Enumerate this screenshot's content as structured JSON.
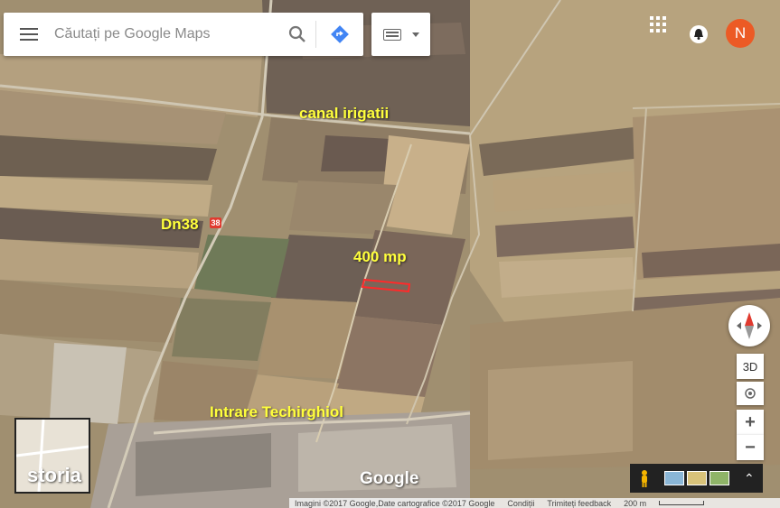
{
  "search": {
    "placeholder": "Căutați pe Google Maps"
  },
  "user": {
    "avatar_letter": "N"
  },
  "map_labels": {
    "canal": "canal irigatii",
    "road": "Dn38",
    "road_shield": "38",
    "plot": "400 mp",
    "entrance": "Intrare Techirghiol"
  },
  "controls": {
    "tilt_3d": "3D",
    "zoom_in": "+",
    "zoom_out": "−",
    "expand": "⌃"
  },
  "watermark": {
    "storia": "storia",
    "google": "Google"
  },
  "attribution": {
    "imagery": "Imagini ©2017 Google,Date cartografice ©2017 Google",
    "terms": "Condiții",
    "feedback": "Trimiteți feedback",
    "scale": "200 m"
  },
  "colors": {
    "label_yellow": "#ffff3c",
    "plot_outline": "#ff2a2a",
    "avatar": "#ec5a25",
    "directions": "#4285f4"
  },
  "icons": {
    "menu": "hamburger-icon",
    "search": "search-icon",
    "directions": "directions-icon",
    "keyboard": "keyboard-icon",
    "apps": "apps-grid-icon",
    "notifications": "bell-icon",
    "pegman": "pegman-icon"
  }
}
